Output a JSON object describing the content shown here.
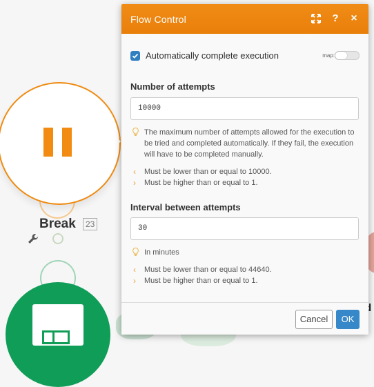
{
  "canvas": {
    "node_label": "Break",
    "node_id": "23",
    "bg_text_right": "d"
  },
  "dialog": {
    "title": "Flow Control",
    "header_icons": [
      "expand-icon",
      "help-icon",
      "close-icon"
    ],
    "help_glyph": "?",
    "close_glyph": "×",
    "auto_complete": {
      "label": "Automatically complete execution",
      "checked": true,
      "map_label": "map:"
    },
    "attempts": {
      "title": "Number of attempts",
      "value": "10000",
      "hint": "The maximum number of attempts allowed for the execution to be tried and completed automatically. If they fail, the execution will have to be completed manually.",
      "rules": [
        "Must be lower than or equal to 10000.",
        "Must be higher than or equal to 1."
      ]
    },
    "interval": {
      "title": "Interval between attempts",
      "value": "30",
      "hint": "In minutes",
      "rules": [
        "Must be lower than or equal to 44640.",
        "Must be higher than or equal to 1."
      ]
    },
    "footer": {
      "cancel_label": "Cancel",
      "ok_label": "OK"
    }
  },
  "colors": {
    "accent": "#f08c16",
    "primary_button": "#3688c9",
    "checkbox": "#2f7fc1"
  }
}
